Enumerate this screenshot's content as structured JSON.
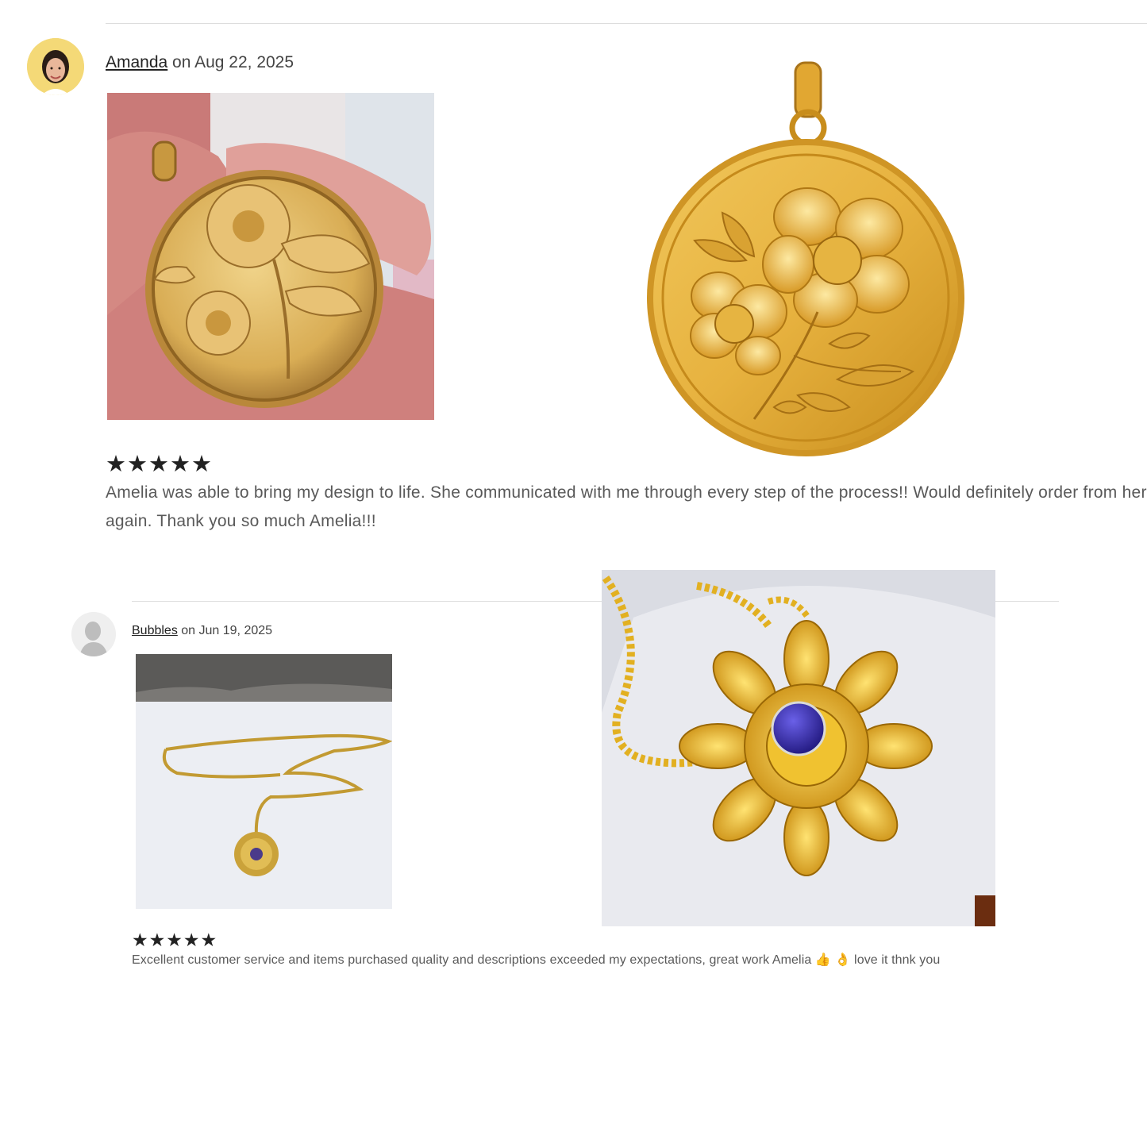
{
  "reviews": [
    {
      "author": "Amanda",
      "date_text": " on Aug 22, 2025",
      "rating_text": "★★★★★",
      "rating": 5,
      "text": "Amelia was able to bring my design to life. She communicated with me through every step of the process!! Would definitely order from her again. Thank you so much Amelia!!!"
    },
    {
      "author": "Bubbles",
      "date_text": " on Jun 19, 2025",
      "rating_text": "★★★★★",
      "rating": 5,
      "text": "Excellent customer service and items purchased quality and descriptions exceeded my expectations, great work Amelia 👍 👌 love it thnk you"
    }
  ],
  "colors": {
    "gold": "#d9a632",
    "gold_light": "#f3cf6a",
    "gold_dark": "#9c6c12",
    "stone": "#3b2fb0",
    "divider": "#dcdcdc"
  },
  "icons": {
    "avatar_1": "user-photo-avatar",
    "avatar_2": "default-silhouette-avatar",
    "rating": "star-icon"
  }
}
